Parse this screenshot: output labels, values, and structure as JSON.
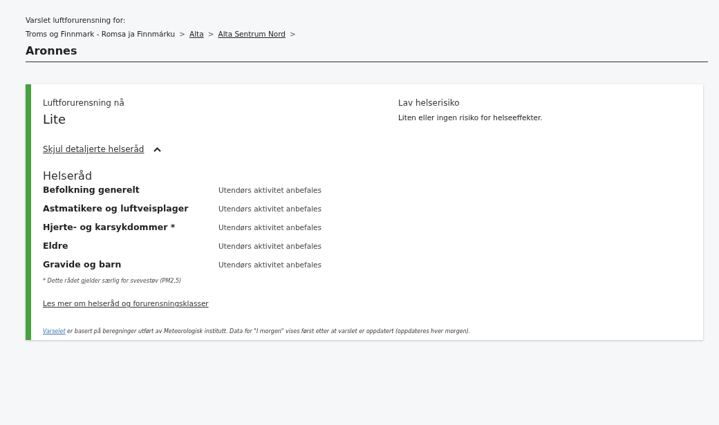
{
  "header": {
    "intro": "Varslet luftforurensning for:",
    "breadcrumb": [
      {
        "label": "Troms og Finnmark - Romsa ja Finnmárku",
        "link": false,
        "separator": ">"
      },
      {
        "label": "Alta",
        "link": true,
        "separator": ">"
      },
      {
        "label": "Alta Sentrum Nord",
        "link": true,
        "separator": ">"
      }
    ],
    "title": "Aronnes"
  },
  "status": {
    "label": "Luftforurensning nå",
    "value": "Lite",
    "risk_title": "Lav helserisiko",
    "risk_text": "Liten eller ingen risiko for helseeffekter."
  },
  "advice": {
    "toggle": "Skjul detaljerte helseråd",
    "expanded": true,
    "heading": "Helseråd",
    "rows": [
      {
        "group": "Befolkning generelt",
        "advice": "Utendørs aktivitet anbefales"
      },
      {
        "group": "Astmatikere og luftveisplager",
        "advice": "Utendørs aktivitet anbefales"
      },
      {
        "group": "Hjerte- og karsykdommer *",
        "advice": "Utendørs aktivitet anbefales"
      },
      {
        "group": "Eldre",
        "advice": "Utendørs aktivitet anbefales"
      },
      {
        "group": "Gravide og barn",
        "advice": "Utendørs aktivitet anbefales"
      }
    ],
    "footnote": "* Dette rådet gjelder særlig for svevestøv (PM2,5)",
    "more_link": "Les mer om helseråd og forurensningsklasser"
  },
  "source_note": {
    "link": "Varselet",
    "text": " er basert på beregninger utført av Meteorologisk institutt. Data for \"I morgen\" vises først etter at varslet er oppdatert (oppdateres hver morgen)."
  }
}
